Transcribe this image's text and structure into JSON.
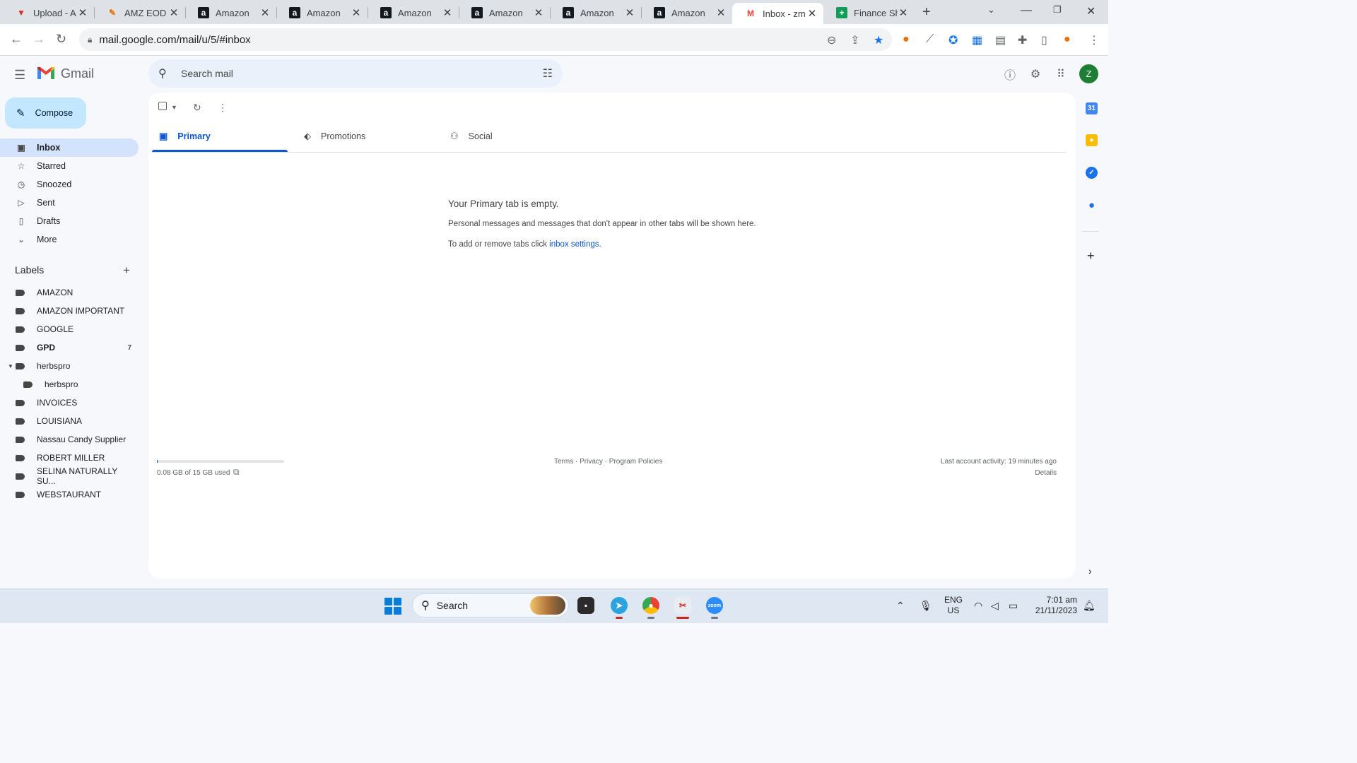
{
  "browser": {
    "tabs": [
      {
        "title": "Upload - A",
        "icon": "upload-favicon"
      },
      {
        "title": "AMZ EOD I",
        "icon": "eod-favicon"
      },
      {
        "title": "Amazon",
        "icon": "amazon-favicon"
      },
      {
        "title": "Amazon",
        "icon": "amazon-favicon"
      },
      {
        "title": "Amazon",
        "icon": "amazon-favicon"
      },
      {
        "title": "Amazon",
        "icon": "amazon-favicon"
      },
      {
        "title": "Amazon",
        "icon": "amazon-favicon"
      },
      {
        "title": "Amazon",
        "icon": "amazon-favicon"
      },
      {
        "title": "Inbox - zm",
        "icon": "gmail-favicon"
      },
      {
        "title": "Finance Sh",
        "icon": "sheets-favicon"
      }
    ],
    "active_tab_index": 8,
    "url": "mail.google.com/mail/u/5/#inbox"
  },
  "gmail": {
    "app_name": "Gmail",
    "search_placeholder": "Search mail",
    "avatar_letter": "Z",
    "compose_label": "Compose",
    "nav": [
      {
        "label": "Inbox",
        "icon": "inbox-icon",
        "active": true
      },
      {
        "label": "Starred",
        "icon": "star-icon"
      },
      {
        "label": "Snoozed",
        "icon": "clock-icon"
      },
      {
        "label": "Sent",
        "icon": "send-icon"
      },
      {
        "label": "Drafts",
        "icon": "draft-icon"
      },
      {
        "label": "More",
        "icon": "chevron-down-icon"
      }
    ],
    "labels_title": "Labels",
    "labels": [
      {
        "name": "AMAZON"
      },
      {
        "name": "AMAZON IMPORTANT"
      },
      {
        "name": "GOOGLE"
      },
      {
        "name": "GPD",
        "count": "7",
        "bold": true
      },
      {
        "name": "herbspro",
        "expanded": true
      },
      {
        "name": "herbspro",
        "child": true
      },
      {
        "name": "INVOICES"
      },
      {
        "name": "LOUISIANA"
      },
      {
        "name": "Nassau Candy Supplier"
      },
      {
        "name": "ROBERT MILLER"
      },
      {
        "name": "SELINA NATURALLY SU..."
      },
      {
        "name": "WEBSTAURANT"
      }
    ],
    "category_tabs": [
      {
        "label": "Primary",
        "icon": "inbox-icon",
        "active": true
      },
      {
        "label": "Promotions",
        "icon": "tag-icon"
      },
      {
        "label": "Social",
        "icon": "people-icon"
      }
    ],
    "empty_state": {
      "title": "Your Primary tab is empty.",
      "line1": "Personal messages and messages that don't appear in other tabs will be shown here.",
      "line2_prefix": "To add or remove tabs click ",
      "line2_link": "inbox settings",
      "line2_suffix": "."
    },
    "footer": {
      "storage_text": "0.08 GB of 15 GB used",
      "storage_fraction": 0.005,
      "links": "Terms · Privacy · Program Policies",
      "last_activity": "Last account activity: 19 minutes ago",
      "details": "Details"
    }
  },
  "taskbar": {
    "search_label": "Search",
    "lang_line1": "ENG",
    "lang_line2": "US",
    "time": "7:01 am",
    "date": "21/11/2023"
  },
  "colors": {
    "accent": "#0b57d0",
    "active_nav_bg": "#d3e3fd",
    "compose_bg": "#c2e7ff",
    "page_bg": "#f6f8fc",
    "avatar_bg": "#1e7e34"
  }
}
